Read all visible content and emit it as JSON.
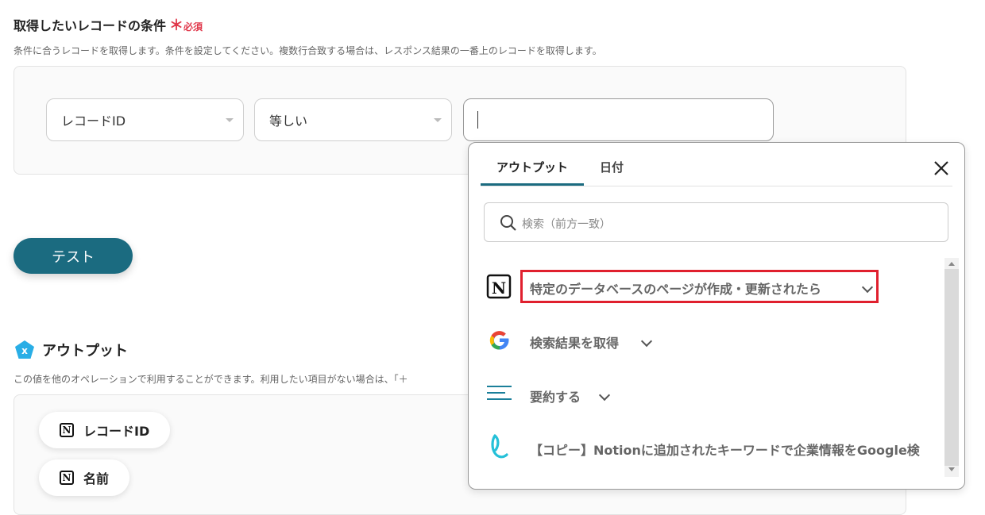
{
  "conditions_section": {
    "title": "取得したいレコードの条件",
    "required_mark": "＊",
    "required_text": "必須",
    "description": "条件に合うレコードを取得します。条件を設定してください。複数行合致する場合は、レスポンス結果の一番上のレコードを取得します。",
    "field_select": "レコードID",
    "operator_select": "等しい",
    "value_input": ""
  },
  "test_button": {
    "label": "テスト"
  },
  "output_section": {
    "title": "アウトプット",
    "description": "この値を他のオペレーションで利用することができます。利用したい項目がない場合は、「＋",
    "chips": [
      {
        "label": "レコードID",
        "icon": "notion-icon"
      },
      {
        "label": "名前",
        "icon": "notion-icon"
      }
    ]
  },
  "popup": {
    "tabs": [
      {
        "label": "アウトプット",
        "active": true
      },
      {
        "label": "日付",
        "active": false
      }
    ],
    "search_placeholder": "検索（前方一致）",
    "items": [
      {
        "label": "特定のデータベースのページが作成・更新されたら",
        "icon": "notion-icon",
        "highlighted": true
      },
      {
        "label": "検索結果を取得",
        "icon": "google-icon"
      },
      {
        "label": "要約する",
        "icon": "summary-lines-icon"
      },
      {
        "label": "【コピー】Notionに追加されたキーワードで企業情報をGoogle検",
        "icon": "yoom-flow-icon"
      }
    ]
  },
  "colors": {
    "accent": "#1b6b80",
    "required": "#e0384b",
    "highlight_border": "#e0202e"
  }
}
